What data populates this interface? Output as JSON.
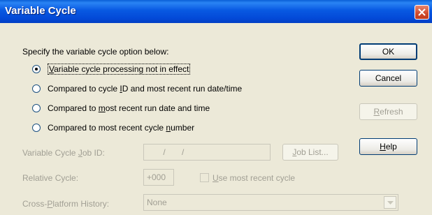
{
  "window": {
    "title": "Variable Cycle"
  },
  "prompt": "Specify the variable cycle option below:",
  "options": [
    {
      "pre": "",
      "key": "V",
      "post": "ariable cycle processing not in effect",
      "selected": true
    },
    {
      "pre": "Compared to cycle ",
      "key": "I",
      "post": "D and most recent run date/time",
      "selected": false
    },
    {
      "pre": "Compared to ",
      "key": "m",
      "post": "ost recent run date and time",
      "selected": false
    },
    {
      "pre": "Compared to most recent cycle ",
      "key": "n",
      "post": "umber",
      "selected": false
    }
  ],
  "buttons": {
    "ok": "OK",
    "cancel": "Cancel",
    "refresh_key": "R",
    "refresh_rest": "efresh",
    "help_key": "H",
    "help_rest": "elp"
  },
  "job_id": {
    "label_pre": "Variable Cycle ",
    "label_key": "J",
    "label_post": "ob ID:",
    "value": "       /       /",
    "list_pre": "",
    "list_key": "J",
    "list_post": "ob List..."
  },
  "relative_cycle": {
    "label": "Relative Cycle:",
    "value": "+000",
    "checkbox_key": "U",
    "checkbox_rest": "se most recent cycle"
  },
  "cross_platform": {
    "label_pre": "Cross-",
    "label_key": "P",
    "label_post": "latform History:",
    "value": "None"
  }
}
